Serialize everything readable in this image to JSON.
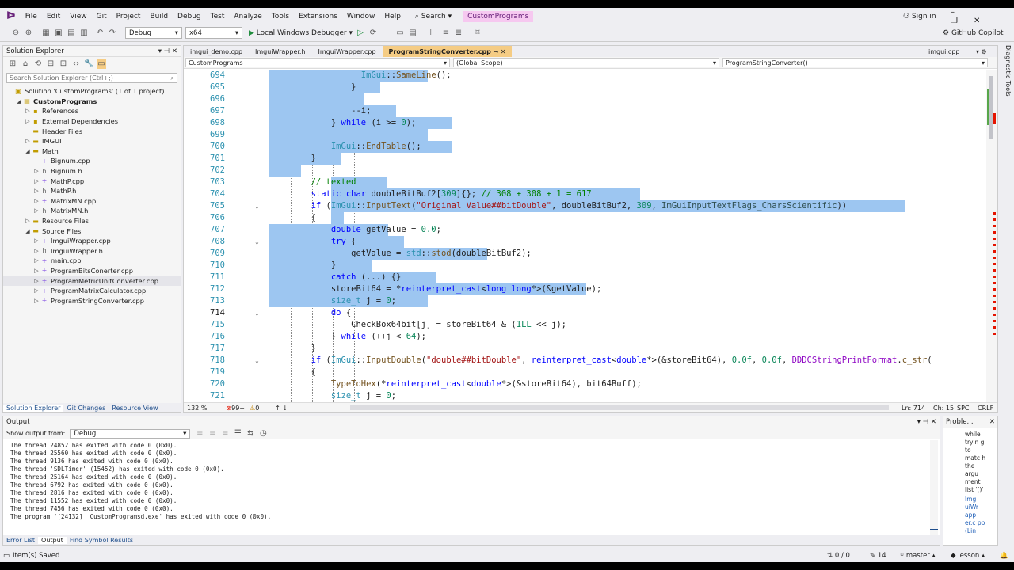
{
  "menu": {
    "items": [
      "File",
      "Edit",
      "View",
      "Git",
      "Project",
      "Build",
      "Debug",
      "Test",
      "Analyze",
      "Tools",
      "Extensions",
      "Window",
      "Help"
    ],
    "search": "Search",
    "solution": "CustomPrograms",
    "signin": "Sign in"
  },
  "toolbar": {
    "config": "Debug",
    "platform": "x64",
    "run": "Local Windows Debugger",
    "copilot": "GitHub Copilot"
  },
  "solution_explorer": {
    "title": "Solution Explorer",
    "search_placeholder": "Search Solution Explorer (Ctrl+;)",
    "items": [
      {
        "label": "Solution 'CustomPrograms' (1 of 1 project)",
        "indent": 0,
        "arrow": "",
        "icon": "▣"
      },
      {
        "label": "CustomPrograms",
        "indent": 1,
        "arrow": "◢",
        "icon": "▤",
        "bold": true
      },
      {
        "label": "References",
        "indent": 2,
        "arrow": "▷",
        "icon": "▪"
      },
      {
        "label": "External Dependencies",
        "indent": 2,
        "arrow": "▷",
        "icon": "▪"
      },
      {
        "label": "Header Files",
        "indent": 2,
        "arrow": "",
        "icon": "▬"
      },
      {
        "label": "IMGUI",
        "indent": 2,
        "arrow": "▷",
        "icon": "▬"
      },
      {
        "label": "Math",
        "indent": 2,
        "arrow": "◢",
        "icon": "▬"
      },
      {
        "label": "Bignum.cpp",
        "indent": 3,
        "arrow": "",
        "icon": "+"
      },
      {
        "label": "Bignum.h",
        "indent": 3,
        "arrow": "▷",
        "icon": "h"
      },
      {
        "label": "MathP.cpp",
        "indent": 3,
        "arrow": "▷",
        "icon": "+"
      },
      {
        "label": "MathP.h",
        "indent": 3,
        "arrow": "▷",
        "icon": "h"
      },
      {
        "label": "MatrixMN.cpp",
        "indent": 3,
        "arrow": "▷",
        "icon": "+"
      },
      {
        "label": "MatrixMN.h",
        "indent": 3,
        "arrow": "▷",
        "icon": "h"
      },
      {
        "label": "Resource Files",
        "indent": 2,
        "arrow": "▷",
        "icon": "▬"
      },
      {
        "label": "Source Files",
        "indent": 2,
        "arrow": "◢",
        "icon": "▬"
      },
      {
        "label": "ImguiWrapper.cpp",
        "indent": 3,
        "arrow": "▷",
        "icon": "+"
      },
      {
        "label": "ImguiWrapper.h",
        "indent": 3,
        "arrow": "▷",
        "icon": "h"
      },
      {
        "label": "main.cpp",
        "indent": 3,
        "arrow": "▷",
        "icon": "+"
      },
      {
        "label": "ProgramBitsConerter.cpp",
        "indent": 3,
        "arrow": "▷",
        "icon": "+"
      },
      {
        "label": "ProgramMetricUnitConverter.cpp",
        "indent": 3,
        "arrow": "▷",
        "icon": "+",
        "selected": true
      },
      {
        "label": "ProgramMatrixCalculator.cpp",
        "indent": 3,
        "arrow": "▷",
        "icon": "+"
      },
      {
        "label": "ProgramStringConverter.cpp",
        "indent": 3,
        "arrow": "▷",
        "icon": "+"
      }
    ],
    "tabs": [
      "Solution Explorer",
      "Git Changes",
      "Resource View"
    ]
  },
  "editor": {
    "tabs": [
      "imgui_demo.cpp",
      "ImguiWrapper.h",
      "ImguiWrapper.cpp",
      "ProgramStringConverter.cpp"
    ],
    "right_tab": "imgui.cpp",
    "nav": [
      "CustomPrograms",
      "(Global Scope)",
      "ProgramStringConverter()"
    ],
    "status": {
      "zoom": "132 %",
      "errors": "99+",
      "warnings": "0",
      "ln": "Ln: 714",
      "ch": "Ch: 15",
      "spc": "SPC",
      "crlf": "CRLF"
    }
  },
  "code_lines": [
    {
      "n": "694",
      "h": [
        [
          "                  ",
          ""
        ],
        [
          "ImGui",
          "ty"
        ],
        [
          "::",
          ""
        ],
        [
          "SameLine",
          "fn"
        ],
        [
          "();",
          ""
        ]
      ]
    },
    {
      "n": "695",
      "h": [
        [
          "                }",
          ""
        ]
      ]
    },
    {
      "n": "696",
      "h": [
        [
          "",
          ""
        ]
      ]
    },
    {
      "n": "697",
      "h": [
        [
          "                --i;",
          ""
        ]
      ]
    },
    {
      "n": "698",
      "h": [
        [
          "            } ",
          ""
        ],
        [
          "while",
          "kw"
        ],
        [
          " (i >= ",
          ""
        ],
        [
          "0",
          "nm"
        ],
        [
          ");",
          ""
        ]
      ]
    },
    {
      "n": "699",
      "h": [
        [
          "",
          ""
        ]
      ]
    },
    {
      "n": "700",
      "h": [
        [
          "            ",
          ""
        ],
        [
          "ImGui",
          "ty"
        ],
        [
          "::",
          ""
        ],
        [
          "EndTable",
          "fn"
        ],
        [
          "();",
          ""
        ]
      ]
    },
    {
      "n": "701",
      "h": [
        [
          "        }",
          ""
        ]
      ]
    },
    {
      "n": "702",
      "h": [
        [
          "",
          ""
        ]
      ]
    },
    {
      "n": "703",
      "h": [
        [
          "        ",
          ""
        ],
        [
          "// texted",
          "cm"
        ]
      ]
    },
    {
      "n": "704",
      "h": [
        [
          "        ",
          ""
        ],
        [
          "static char",
          "kw"
        ],
        [
          " doubleBitBuf2[",
          ""
        ],
        [
          "309",
          "nm"
        ],
        [
          "]{}; ",
          ""
        ],
        [
          "// 308 + 308 + 1 = 617",
          "cm"
        ]
      ]
    },
    {
      "n": "705",
      "h": [
        [
          "        ",
          ""
        ],
        [
          "if",
          "kw"
        ],
        [
          " (",
          ""
        ],
        [
          "ImGui",
          "ty"
        ],
        [
          "::",
          ""
        ],
        [
          "InputText",
          "fn"
        ],
        [
          "(",
          ""
        ],
        [
          "\"Original Value##bitDouble\"",
          "st"
        ],
        [
          ", doubleBitBuf2, ",
          ""
        ],
        [
          "309",
          "nm"
        ],
        [
          ", ",
          ""
        ],
        [
          "ImGuiInputTextFlags_CharsScientific",
          "en"
        ],
        [
          "))",
          ""
        ]
      ]
    },
    {
      "n": "706",
      "h": [
        [
          "        {",
          ""
        ]
      ]
    },
    {
      "n": "707",
      "h": [
        [
          "            ",
          ""
        ],
        [
          "double",
          "kw"
        ],
        [
          " getValue = ",
          ""
        ],
        [
          "0.0",
          "nm"
        ],
        [
          ";",
          ""
        ]
      ]
    },
    {
      "n": "708",
      "h": [
        [
          "            ",
          ""
        ],
        [
          "try",
          "kw"
        ],
        [
          " {",
          ""
        ]
      ]
    },
    {
      "n": "709",
      "h": [
        [
          "                getValue = ",
          ""
        ],
        [
          "std",
          "ty"
        ],
        [
          "::",
          ""
        ],
        [
          "stod",
          "fn"
        ],
        [
          "(doubleBitBuf2);",
          ""
        ]
      ]
    },
    {
      "n": "710",
      "h": [
        [
          "            }",
          ""
        ]
      ]
    },
    {
      "n": "711",
      "h": [
        [
          "            ",
          ""
        ],
        [
          "catch",
          "kw"
        ],
        [
          " (...) {}",
          ""
        ]
      ]
    },
    {
      "n": "712",
      "h": [
        [
          "            storeBit64 = *",
          ""
        ],
        [
          "reinterpret_cast",
          "kw"
        ],
        [
          "<",
          ""
        ],
        [
          "long long",
          "kw"
        ],
        [
          "*>(&getValue);",
          ""
        ]
      ]
    },
    {
      "n": "713",
      "h": [
        [
          "            ",
          ""
        ],
        [
          "size_t",
          "ty"
        ],
        [
          " j = ",
          ""
        ],
        [
          "0",
          "nm"
        ],
        [
          ";",
          ""
        ]
      ]
    },
    {
      "n": "714",
      "h": [
        [
          "            ",
          ""
        ],
        [
          "do",
          "kw"
        ],
        [
          " {",
          ""
        ]
      ]
    },
    {
      "n": "715",
      "h": [
        [
          "                CheckBox64bit[j] = storeBit64 & (",
          ""
        ],
        [
          "1LL",
          "nm"
        ],
        [
          " << j);",
          ""
        ]
      ]
    },
    {
      "n": "716",
      "h": [
        [
          "            } ",
          ""
        ],
        [
          "while",
          "kw"
        ],
        [
          " (++j < ",
          ""
        ],
        [
          "64",
          "nm"
        ],
        [
          ");",
          ""
        ]
      ]
    },
    {
      "n": "717",
      "h": [
        [
          "        }",
          ""
        ]
      ]
    },
    {
      "n": "718",
      "h": [
        [
          "        ",
          ""
        ],
        [
          "if",
          "kw"
        ],
        [
          " (",
          ""
        ],
        [
          "ImGui",
          "ty"
        ],
        [
          "::",
          ""
        ],
        [
          "InputDouble",
          "fn"
        ],
        [
          "(",
          ""
        ],
        [
          "\"double##bitDouble\"",
          "st"
        ],
        [
          ", ",
          ""
        ],
        [
          "reinterpret_cast",
          "kw"
        ],
        [
          "<",
          ""
        ],
        [
          "double",
          "kw"
        ],
        [
          "*>(&storeBit64), ",
          ""
        ],
        [
          "0.0f",
          "nm"
        ],
        [
          ", ",
          ""
        ],
        [
          "0.0f",
          "nm"
        ],
        [
          ", ",
          ""
        ],
        [
          "DDDCStringPrintFormat",
          "mc"
        ],
        [
          ".",
          ""
        ],
        [
          "c_str",
          "fn"
        ],
        [
          "(",
          ""
        ]
      ]
    },
    {
      "n": "719",
      "h": [
        [
          "        {",
          ""
        ]
      ]
    },
    {
      "n": "720",
      "h": [
        [
          "            ",
          ""
        ],
        [
          "TypeToHex",
          "fn"
        ],
        [
          "(*",
          ""
        ],
        [
          "reinterpret_cast",
          "kw"
        ],
        [
          "<",
          ""
        ],
        [
          "double",
          "kw"
        ],
        [
          "*>(&storeBit64), bit64Buff);",
          ""
        ]
      ]
    },
    {
      "n": "721",
      "h": [
        [
          "            ",
          ""
        ],
        [
          "size_t",
          "ty"
        ],
        [
          " j = ",
          ""
        ],
        [
          "0",
          "nm"
        ],
        [
          ";",
          ""
        ]
      ]
    }
  ],
  "output": {
    "title": "Output",
    "show_from": "Show output from:",
    "source": "Debug",
    "lines": [
      "The thread 24852 has exited with code 0 (0x0).",
      "The thread 25560 has exited with code 0 (0x0).",
      "The thread 9136 has exited with code 0 (0x0).",
      "The thread 'SDLTimer' (15452) has exited with code 0 (0x0).",
      "The thread 25164 has exited with code 0 (0x0).",
      "The thread 6792 has exited with code 0 (0x0).",
      "The thread 2816 has exited with code 0 (0x0).",
      "The thread 11552 has exited with code 0 (0x0).",
      "The thread 7456 has exited with code 0 (0x0).",
      "The program '[24132]  CustomProgramsd.exe' has exited with code 0 (0x0)."
    ],
    "tabs": [
      "Error List",
      "Output",
      "Find Symbol Results"
    ]
  },
  "problems": {
    "title": "Proble...",
    "text": "while tryin g to matc h the argu ment list '()'",
    "link": "Img uiWr app er.c pp (Lin"
  },
  "statusbar": {
    "left": "Item(s) Saved",
    "updown": "0 / 0",
    "edits": "14",
    "branch": "master",
    "repo": "lesson"
  },
  "diag": "Diagnostic Tools"
}
